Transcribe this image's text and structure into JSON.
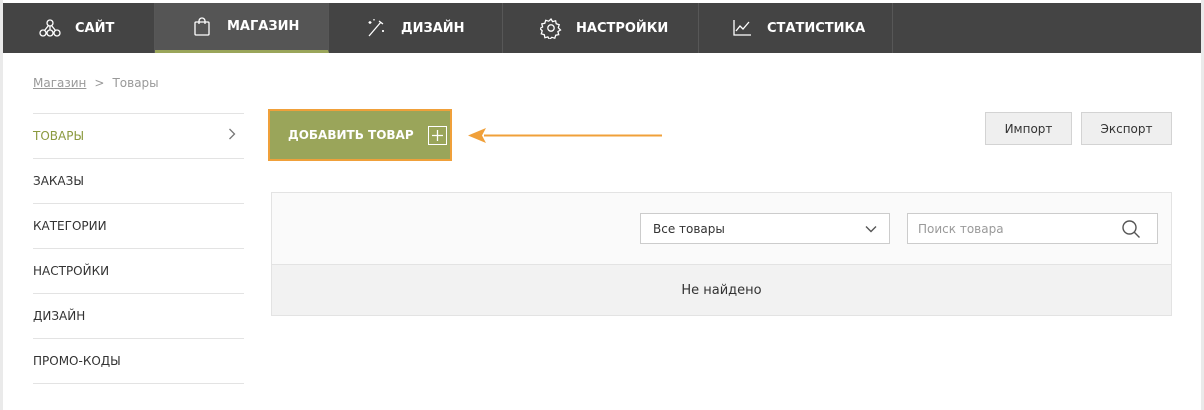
{
  "topnav": {
    "items": [
      {
        "label": "САЙТ",
        "icon": "sitemap-icon"
      },
      {
        "label": "МАГАЗИН",
        "icon": "shopping-bag-icon"
      },
      {
        "label": "ДИЗАЙН",
        "icon": "magic-wand-icon"
      },
      {
        "label": "НАСТРОЙКИ",
        "icon": "gear-icon"
      },
      {
        "label": "СТАТИСТИКА",
        "icon": "line-chart-icon"
      }
    ],
    "active_index": 1
  },
  "breadcrumb": {
    "link": "Магазин",
    "separator": ">",
    "current": "Товары"
  },
  "sidebar": {
    "items": [
      {
        "label": "ТОВАРЫ"
      },
      {
        "label": "ЗАКАЗЫ"
      },
      {
        "label": "КАТЕГОРИИ"
      },
      {
        "label": "НАСТРОЙКИ"
      },
      {
        "label": "ДИЗАЙН"
      },
      {
        "label": "ПРОМО-КОДЫ"
      }
    ],
    "active_index": 0
  },
  "toolbar": {
    "add_label": "ДОБАВИТЬ ТОВАР",
    "import_label": "Импорт",
    "export_label": "Экспорт"
  },
  "filter": {
    "selected": "Все товары"
  },
  "search": {
    "placeholder": "Поиск товара",
    "value": ""
  },
  "results": {
    "empty_text": "Не найдено"
  },
  "colors": {
    "nav_bg": "#444444",
    "accent_green": "#9aa55a",
    "highlight_orange": "#f0a03a",
    "active_sidebar": "#8b9a3f"
  }
}
